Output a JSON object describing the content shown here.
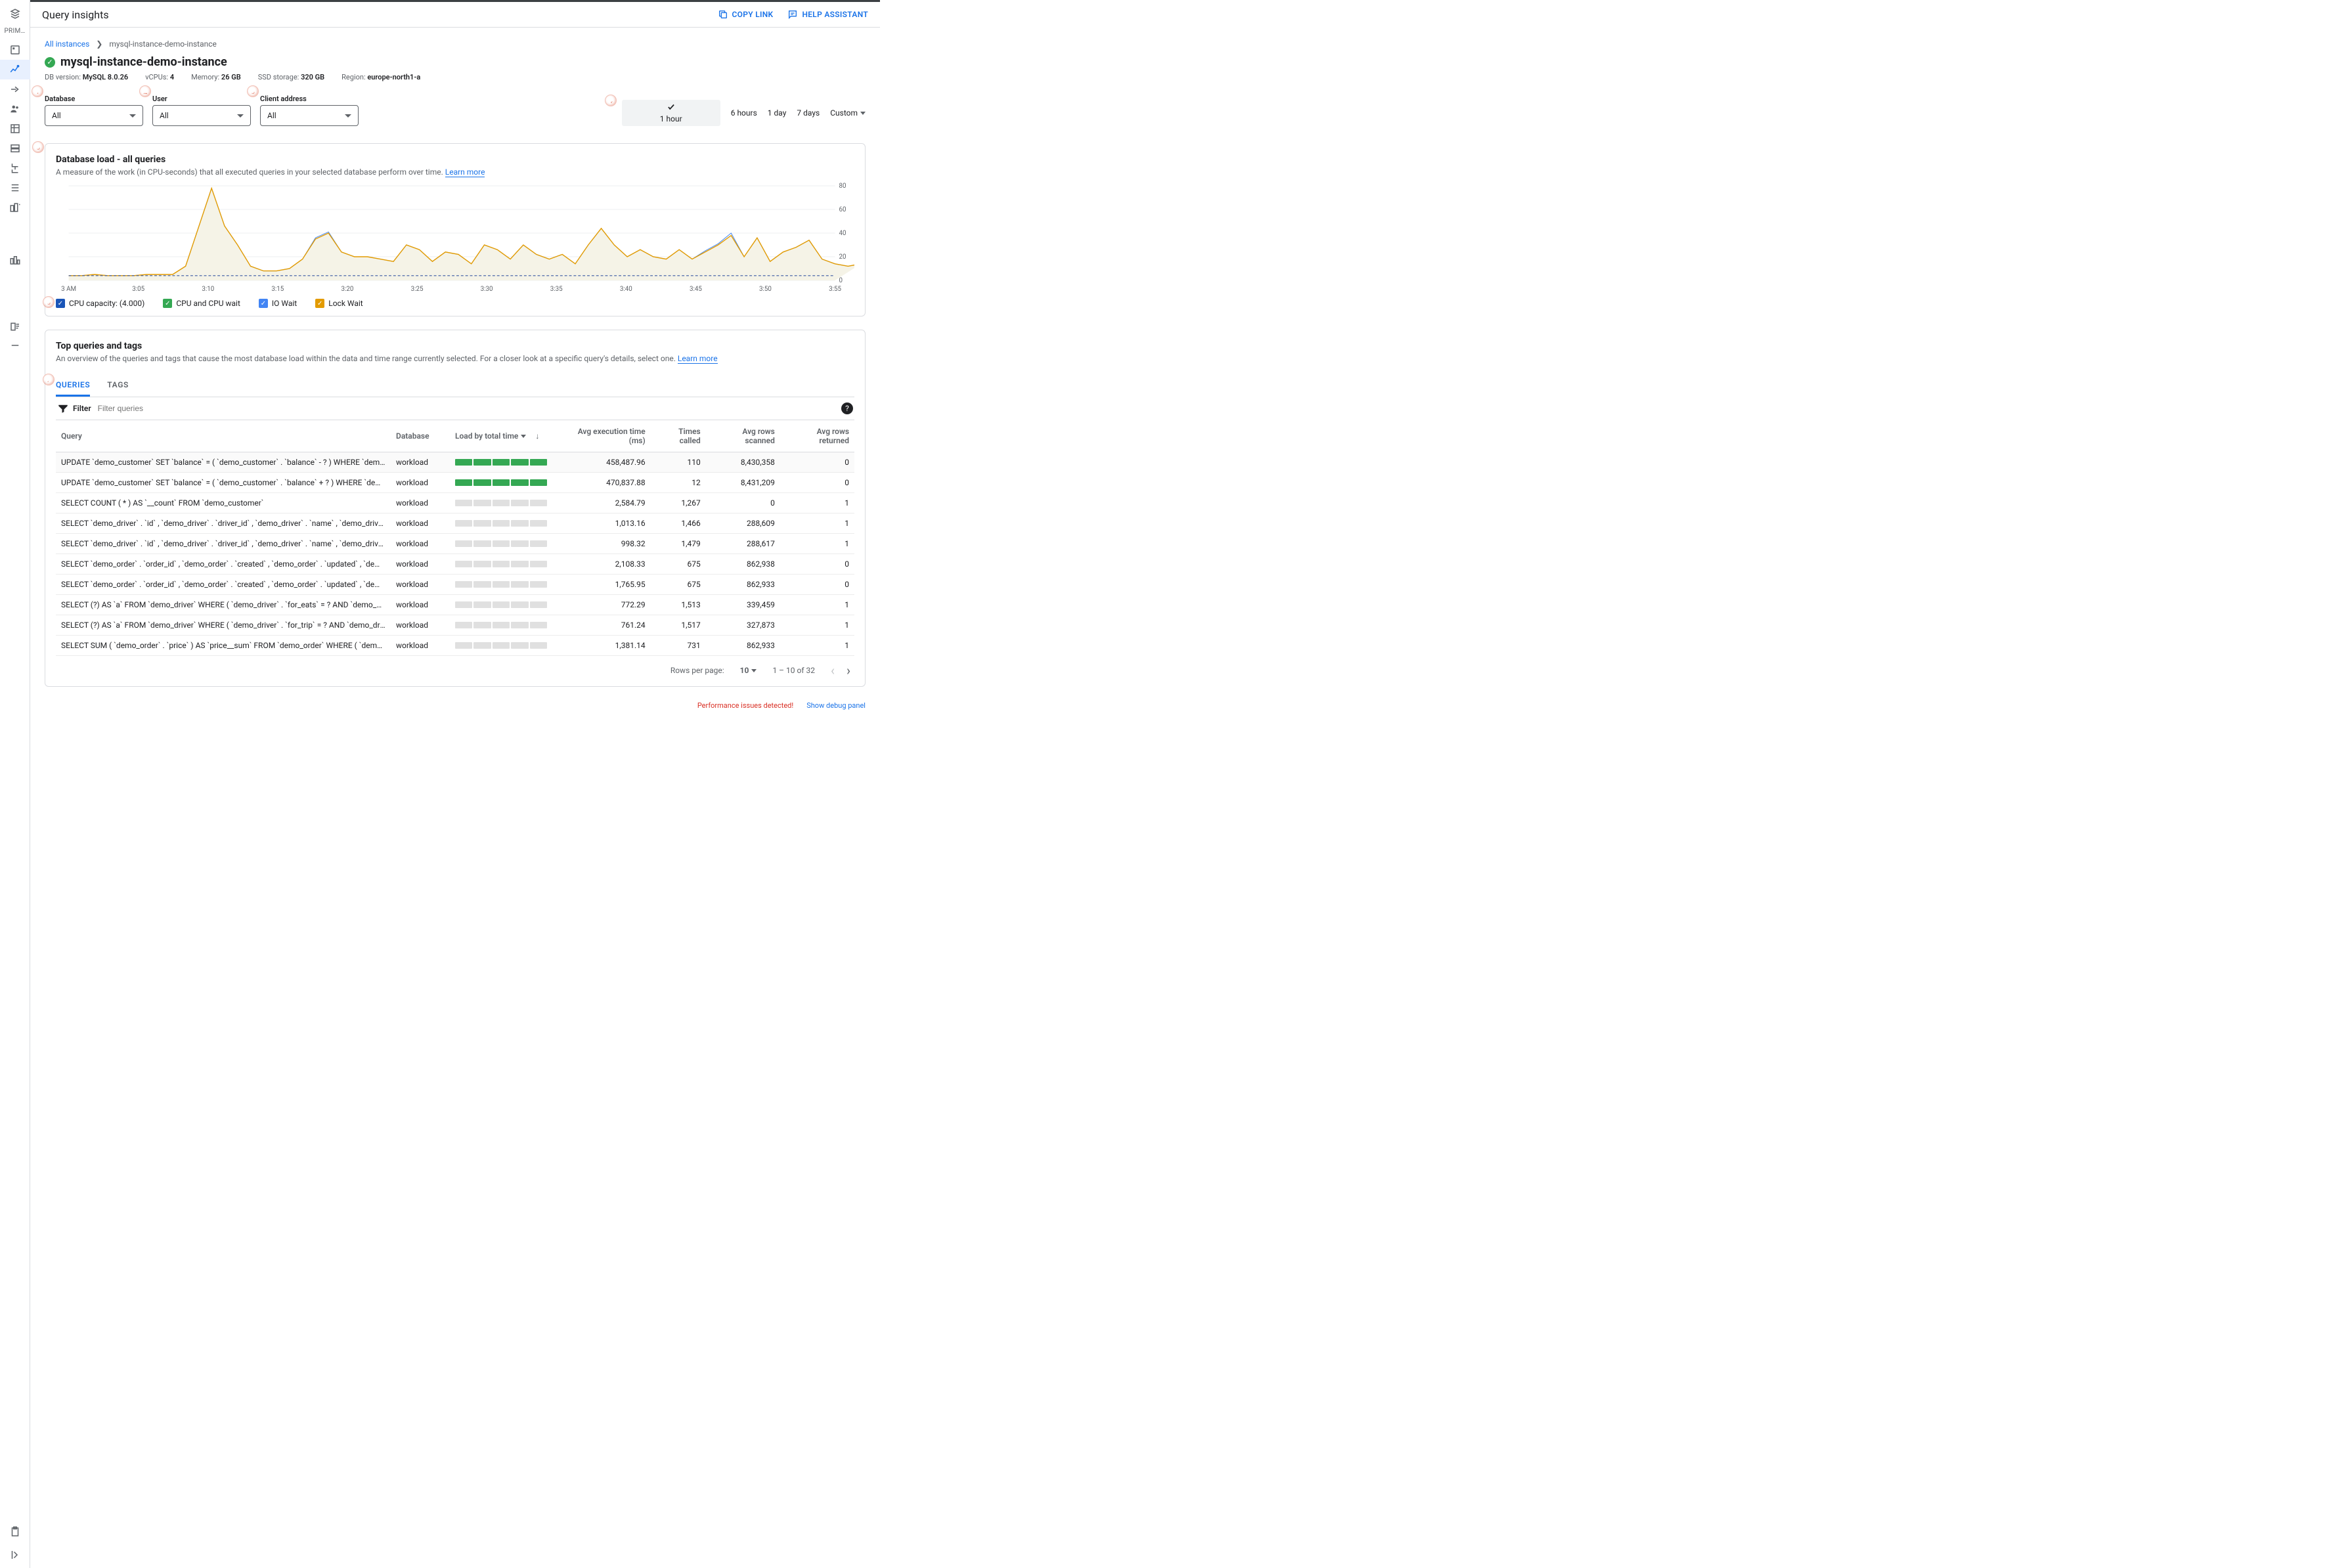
{
  "header": {
    "title": "Query insights",
    "copy_link": "COPY LINK",
    "help_assistant": "HELP ASSISTANT"
  },
  "nav": {
    "section_label": "PRIM…"
  },
  "breadcrumbs": {
    "root": "All instances",
    "current": "mysql-instance-demo-instance"
  },
  "instance": {
    "name": "mysql-instance-demo-instance",
    "meta": {
      "db_version_label": "DB version:",
      "db_version": "MySQL 8.0.26",
      "vcpus_label": "vCPUs:",
      "vcpus": "4",
      "memory_label": "Memory:",
      "memory": "26 GB",
      "ssd_label": "SSD storage:",
      "ssd": "320 GB",
      "region_label": "Region:",
      "region": "europe-north1-a"
    }
  },
  "filters": {
    "database": {
      "label": "Database",
      "value": "All"
    },
    "user": {
      "label": "User",
      "value": "All"
    },
    "client": {
      "label": "Client address",
      "value": "All"
    }
  },
  "timerange": {
    "options": [
      "1 hour",
      "6 hours",
      "1 day",
      "7 days",
      "Custom"
    ],
    "selected": "1 hour"
  },
  "load_card": {
    "title": "Database load - all queries",
    "subtitle": "A measure of the work (in CPU-seconds) that all executed queries in your selected database perform over time.",
    "learn_more": "Learn more",
    "legend": {
      "capacity": "CPU capacity: (4.000)",
      "cpu": "CPU and CPU wait",
      "io": "IO Wait",
      "lock": "Lock Wait"
    }
  },
  "top_card": {
    "title": "Top queries and tags",
    "subtitle": "An overview of the queries and tags that cause the most database load within the data and time range currently selected. For a closer look at a specific query's details, select one.",
    "learn_more": "Learn more"
  },
  "tabs": {
    "queries": "QUERIES",
    "tags": "TAGS"
  },
  "table": {
    "filter_label": "Filter",
    "filter_placeholder": "Filter queries",
    "columns": {
      "query": "Query",
      "database": "Database",
      "load": "Load by total time",
      "avg_exec": "Avg execution time (ms)",
      "times_called": "Times called",
      "avg_scanned": "Avg rows scanned",
      "avg_returned": "Avg rows returned"
    },
    "rows": [
      {
        "query": "UPDATE `demo_customer` SET `balance` = ( `demo_customer` . `balance` - ? ) WHERE `demo_customer` . `name` = ?",
        "database": "workload",
        "load": 1.0,
        "avg_exec": "458,487.96",
        "times_called": "110",
        "avg_scanned": "8,430,358",
        "avg_returned": "0"
      },
      {
        "query": "UPDATE `demo_customer` SET `balance` = ( `demo_customer` . `balance` + ? ) WHERE `demo_customer` . `name` = ?",
        "database": "workload",
        "load": 0.98,
        "avg_exec": "470,837.88",
        "times_called": "12",
        "avg_scanned": "8,431,209",
        "avg_returned": "0"
      },
      {
        "query": "SELECT COUNT ( * ) AS `__count` FROM `demo_customer`",
        "database": "workload",
        "load": 0.07,
        "avg_exec": "2,584.79",
        "times_called": "1,267",
        "avg_scanned": "0",
        "avg_returned": "1"
      },
      {
        "query": "SELECT `demo_driver` . `id` , `demo_driver` . `driver_id` , `demo_driver` . `name` , `demo_driver` . `address` , `demo_driver` . …",
        "database": "workload",
        "load": 0.04,
        "avg_exec": "1,013.16",
        "times_called": "1,466",
        "avg_scanned": "288,609",
        "avg_returned": "1"
      },
      {
        "query": "SELECT `demo_driver` . `id` , `demo_driver` . `driver_id` , `demo_driver` . `name` , `demo_driver` . `address` , `demo_driver` . …",
        "database": "workload",
        "load": 0.04,
        "avg_exec": "998.32",
        "times_called": "1,479",
        "avg_scanned": "288,617",
        "avg_returned": "1"
      },
      {
        "query": "SELECT `demo_order` . `order_id` , `demo_order` . `created` , `demo_order` . `updated` , `demo_order` . `city` , `demo_order` . …",
        "database": "workload",
        "load": 0.04,
        "avg_exec": "2,108.33",
        "times_called": "675",
        "avg_scanned": "862,938",
        "avg_returned": "0"
      },
      {
        "query": "SELECT `demo_order` . `order_id` , `demo_order` . `created` , `demo_order` . `updated` , `demo_order` . `city` , `demo_order` . …",
        "database": "workload",
        "load": 0.03,
        "avg_exec": "1,765.95",
        "times_called": "675",
        "avg_scanned": "862,933",
        "avg_returned": "0"
      },
      {
        "query": "SELECT (?) AS `a` FROM `demo_driver` WHERE ( `demo_driver` . `for_eats` = ? AND `demo_driver` . `current_order_id` …",
        "database": "workload",
        "load": 0.03,
        "avg_exec": "772.29",
        "times_called": "1,513",
        "avg_scanned": "339,459",
        "avg_returned": "1"
      },
      {
        "query": "SELECT (?) AS `a` FROM `demo_driver` WHERE ( `demo_driver` . `for_trip` = ? AND `demo_driver` . `current_order_id` …",
        "database": "workload",
        "load": 0.03,
        "avg_exec": "761.24",
        "times_called": "1,517",
        "avg_scanned": "327,873",
        "avg_returned": "1"
      },
      {
        "query": "SELECT SUM ( `demo_order` . `price` ) AS `price__sum` FROM `demo_order` WHERE ( `demo_order` . `customer_id` …",
        "database": "workload",
        "load": 0.03,
        "avg_exec": "1,381.14",
        "times_called": "731",
        "avg_scanned": "862,933",
        "avg_returned": "1"
      }
    ]
  },
  "pagination": {
    "rows_per_page_label": "Rows per page:",
    "rows_per_page": "10",
    "range": "1 – 10 of 32"
  },
  "status": {
    "error": "Performance issues detected!",
    "debug": "Show debug panel"
  },
  "chart_data": {
    "type": "line",
    "xlabel": "",
    "ylabel": "",
    "ylim": [
      0,
      80
    ],
    "x_tick_labels": [
      "3 AM",
      "3:05",
      "3:10",
      "3:15",
      "3:20",
      "3:25",
      "3:30",
      "3:35",
      "3:40",
      "3:45",
      "3:50",
      "3:55"
    ],
    "annotations": {
      "cpu_capacity_line": 4.0
    },
    "series": [
      {
        "name": "orange (CPU+Lock stacked top)",
        "color": "#e39b00",
        "fill": "#f5f3e7",
        "x": [
          0,
          1,
          2,
          3,
          4,
          5,
          6,
          7,
          8,
          9,
          10,
          11,
          12,
          13,
          14,
          15,
          16,
          17,
          18,
          19,
          20,
          21,
          22,
          23,
          24,
          25,
          26,
          27,
          28,
          29,
          30,
          31,
          32,
          33,
          34,
          35,
          36,
          37,
          38,
          39,
          40,
          41,
          42,
          43,
          44,
          45,
          46,
          47,
          48,
          49,
          50,
          51,
          52,
          53,
          54,
          55,
          56,
          57,
          58,
          59
        ],
        "values": [
          4,
          4,
          5,
          4,
          4,
          4,
          5,
          5,
          5,
          12,
          45,
          78,
          46,
          30,
          12,
          8,
          8,
          10,
          18,
          35,
          40,
          24,
          20,
          20,
          18,
          16,
          30,
          26,
          16,
          24,
          22,
          14,
          30,
          26,
          18,
          30,
          22,
          18,
          22,
          14,
          30,
          44,
          30,
          20,
          26,
          20,
          18,
          26,
          18,
          24,
          30,
          38,
          20,
          36,
          16,
          24,
          28,
          34,
          18,
          14,
          12,
          14
        ]
      },
      {
        "name": "blue (IO Wait peek)",
        "color": "#4285f4",
        "x": [
          0,
          1,
          2,
          3,
          4,
          5,
          6,
          7,
          8,
          9,
          10,
          11,
          12,
          13,
          14,
          15,
          16,
          17,
          18,
          19,
          20,
          21,
          22,
          23,
          24,
          25,
          26,
          27,
          28,
          29,
          30,
          31,
          32,
          33,
          34,
          35,
          36,
          37,
          38,
          39,
          40,
          41,
          42,
          43,
          44,
          45,
          46,
          47,
          48,
          49,
          50,
          51,
          52,
          53,
          54,
          55,
          56,
          57,
          58,
          59
        ],
        "values": [
          4,
          4,
          5,
          4,
          4,
          4,
          5,
          5,
          5,
          12,
          45,
          78,
          46,
          30,
          12,
          8,
          8,
          10,
          18,
          36,
          41,
          24,
          20,
          20,
          18,
          16,
          30,
          26,
          16,
          24,
          22,
          14,
          30,
          26,
          18,
          30,
          22,
          18,
          22,
          14,
          30,
          44,
          30,
          20,
          26,
          20,
          18,
          26,
          18,
          25,
          31,
          40,
          20,
          36,
          16,
          24,
          28,
          34,
          18,
          14,
          12,
          14
        ]
      }
    ]
  }
}
